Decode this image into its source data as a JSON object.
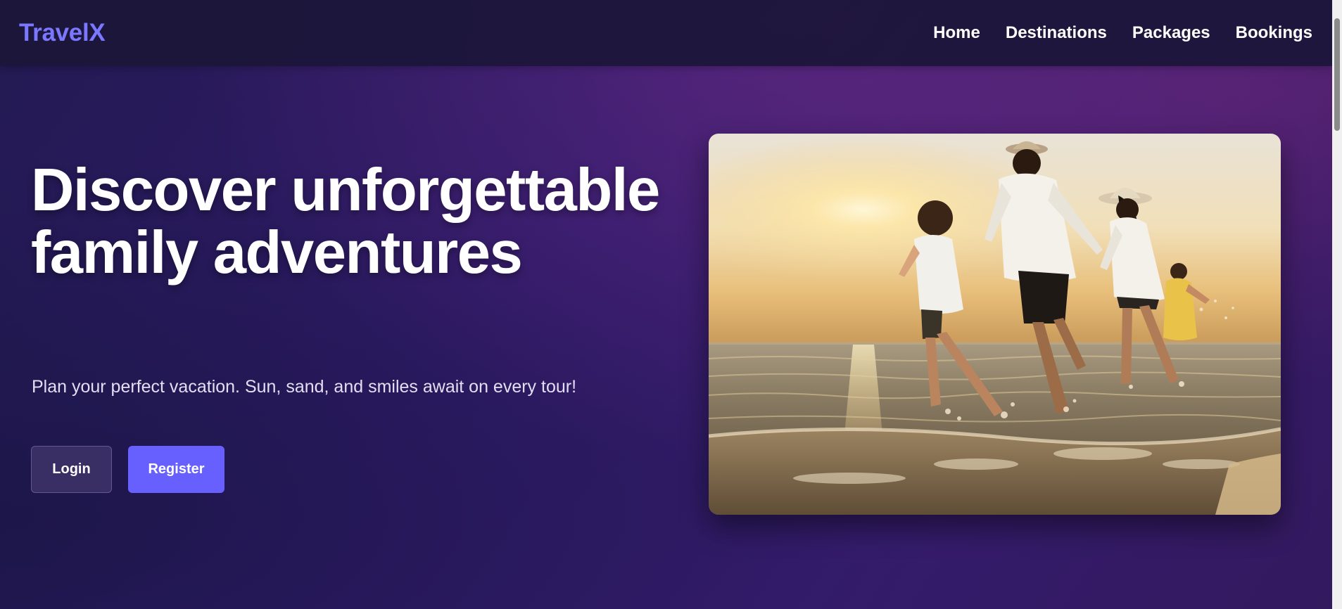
{
  "brand": {
    "name": "TravelX",
    "color": "#7b78ff"
  },
  "nav": {
    "items": [
      {
        "label": "Home"
      },
      {
        "label": "Destinations"
      },
      {
        "label": "Packages"
      },
      {
        "label": "Bookings"
      }
    ]
  },
  "hero": {
    "title": "Discover unforgettable family adventures",
    "subtitle": "Plan your perfect vacation. Sun, sand, and smiles await on every tour!",
    "buttons": {
      "login_label": "Login",
      "register_label": "Register"
    },
    "accent_color": "#6760ff",
    "image_alt": "family running on the beach at sunset"
  }
}
